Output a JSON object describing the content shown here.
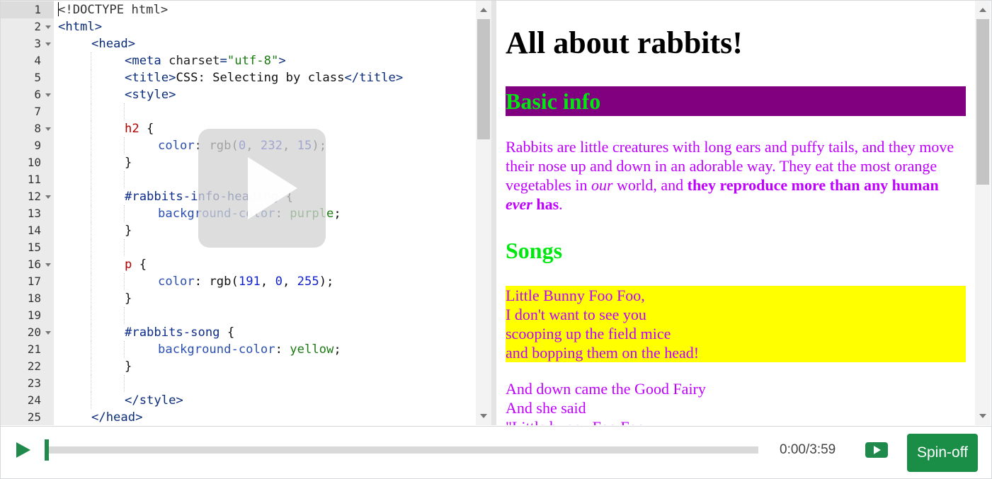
{
  "editor": {
    "lines": [
      {
        "n": "1",
        "fold": false,
        "active": true,
        "indent": 0,
        "tokens": [
          [
            "t-doc",
            "<!DOCTYPE html>"
          ]
        ]
      },
      {
        "n": "2",
        "fold": true,
        "indent": 0,
        "tokens": [
          [
            "t-tag",
            "<html>"
          ]
        ]
      },
      {
        "n": "3",
        "fold": true,
        "indent": 1,
        "tokens": [
          [
            "t-tag",
            "<head>"
          ]
        ]
      },
      {
        "n": "4",
        "fold": false,
        "indent": 2,
        "tokens": [
          [
            "t-tag",
            "<meta "
          ],
          [
            "t-attr",
            "charset"
          ],
          [
            "t-tag",
            "="
          ],
          [
            "t-str",
            "\"utf-8\""
          ],
          [
            "t-tag",
            ">"
          ]
        ]
      },
      {
        "n": "5",
        "fold": false,
        "indent": 2,
        "tokens": [
          [
            "t-tag",
            "<title>"
          ],
          [
            "t-text",
            "CSS: Selecting by class"
          ],
          [
            "t-tag",
            "</title>"
          ]
        ]
      },
      {
        "n": "6",
        "fold": true,
        "indent": 2,
        "tokens": [
          [
            "t-tag",
            "<style>"
          ]
        ]
      },
      {
        "n": "7",
        "fold": false,
        "indent": 2,
        "tokens": []
      },
      {
        "n": "8",
        "fold": true,
        "indent": 2,
        "tokens": [
          [
            "t-sel",
            "h2"
          ],
          [
            "t-text",
            " {"
          ]
        ]
      },
      {
        "n": "9",
        "fold": false,
        "indent": 3,
        "tokens": [
          [
            "t-prop",
            "color"
          ],
          [
            "t-text",
            ": rgb("
          ],
          [
            "t-num",
            "0"
          ],
          [
            "t-text",
            ", "
          ],
          [
            "t-num",
            "232"
          ],
          [
            "t-text",
            ", "
          ],
          [
            "t-num",
            "15"
          ],
          [
            "t-text",
            ");"
          ]
        ]
      },
      {
        "n": "10",
        "fold": false,
        "indent": 2,
        "tokens": [
          [
            "t-text",
            "}"
          ]
        ]
      },
      {
        "n": "11",
        "fold": false,
        "indent": 2,
        "tokens": []
      },
      {
        "n": "12",
        "fold": true,
        "indent": 2,
        "tokens": [
          [
            "t-id",
            "#rabbits-info-heading"
          ],
          [
            "t-text",
            " {"
          ]
        ]
      },
      {
        "n": "13",
        "fold": false,
        "indent": 3,
        "tokens": [
          [
            "t-prop",
            "background-color"
          ],
          [
            "t-text",
            ": "
          ],
          [
            "t-kw",
            "purple"
          ],
          [
            "t-text",
            ";"
          ]
        ]
      },
      {
        "n": "14",
        "fold": false,
        "indent": 2,
        "tokens": [
          [
            "t-text",
            "}"
          ]
        ]
      },
      {
        "n": "15",
        "fold": false,
        "indent": 2,
        "tokens": []
      },
      {
        "n": "16",
        "fold": true,
        "indent": 2,
        "tokens": [
          [
            "t-sel",
            "p"
          ],
          [
            "t-text",
            " {"
          ]
        ]
      },
      {
        "n": "17",
        "fold": false,
        "indent": 3,
        "tokens": [
          [
            "t-prop",
            "color"
          ],
          [
            "t-text",
            ": rgb("
          ],
          [
            "t-num",
            "191"
          ],
          [
            "t-text",
            ", "
          ],
          [
            "t-num",
            "0"
          ],
          [
            "t-text",
            ", "
          ],
          [
            "t-num",
            "255"
          ],
          [
            "t-text",
            ");"
          ]
        ]
      },
      {
        "n": "18",
        "fold": false,
        "indent": 2,
        "tokens": [
          [
            "t-text",
            "}"
          ]
        ]
      },
      {
        "n": "19",
        "fold": false,
        "indent": 2,
        "tokens": []
      },
      {
        "n": "20",
        "fold": true,
        "indent": 2,
        "tokens": [
          [
            "t-id",
            "#rabbits-song"
          ],
          [
            "t-text",
            " {"
          ]
        ]
      },
      {
        "n": "21",
        "fold": false,
        "indent": 3,
        "tokens": [
          [
            "t-prop",
            "background-color"
          ],
          [
            "t-text",
            ": "
          ],
          [
            "t-kw",
            "yellow"
          ],
          [
            "t-text",
            ";"
          ]
        ]
      },
      {
        "n": "22",
        "fold": false,
        "indent": 2,
        "tokens": [
          [
            "t-text",
            "}"
          ]
        ]
      },
      {
        "n": "23",
        "fold": false,
        "indent": 2,
        "tokens": []
      },
      {
        "n": "24",
        "fold": false,
        "indent": 2,
        "tokens": [
          [
            "t-tag",
            "</style>"
          ]
        ]
      },
      {
        "n": "25",
        "fold": false,
        "indent": 1,
        "tokens": [
          [
            "t-tag",
            "</head>"
          ]
        ]
      }
    ]
  },
  "preview": {
    "h1": "All about rabbits!",
    "basic_heading": "Basic info",
    "para": {
      "a": "Rabbits are little creatures with long ears and puffy tails, and they move their nose up and down in an adorable way. They eat the most orange vegetables in ",
      "em1": "our",
      "b": " world, and ",
      "strong1": "they reproduce more than any human ",
      "strong_em": "ever",
      "strong2": " has",
      "c": "."
    },
    "songs_heading": "Songs",
    "song1": [
      "Little Bunny Foo Foo,",
      "I don't want to see you",
      "scooping up the field mice",
      "and bopping them on the head!"
    ],
    "song2": [
      "And down came the Good Fairy",
      "And she said",
      "\"Little bunny Foo Foo"
    ]
  },
  "player": {
    "time": "0:00/3:59",
    "spinoff_label": "Spin-off",
    "progress": 0
  }
}
